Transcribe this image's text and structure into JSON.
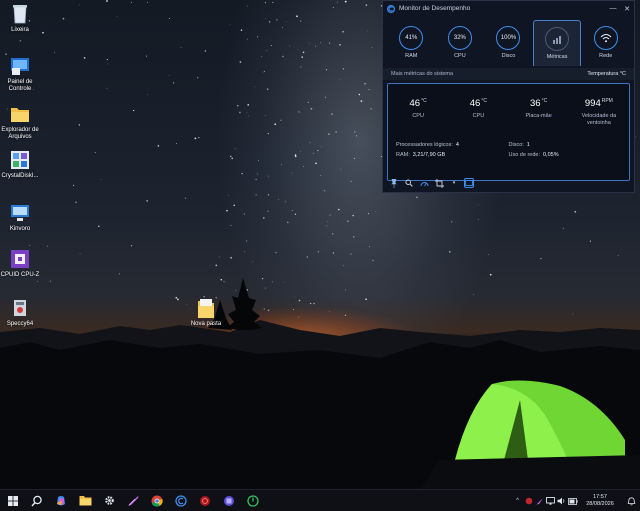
{
  "desktop": {
    "icons": [
      {
        "label": "Lixeira",
        "icon": "recycle-bin-icon"
      },
      {
        "label": "Painel de Controle",
        "icon": "control-panel-icon"
      },
      {
        "label": "Explorador de Arquivos",
        "icon": "folder-icon"
      },
      {
        "label": "CrystalDiskI...",
        "icon": "crystaldisk-icon"
      },
      {
        "label": "Kinvoro",
        "icon": "monitor-app-icon"
      },
      {
        "label": "CPUID CPU-Z",
        "icon": "cpuz-icon"
      },
      {
        "label": "Speccy64",
        "icon": "speccy-icon"
      },
      {
        "label": "Nova pasta",
        "icon": "new-folder-icon"
      }
    ]
  },
  "perf_window": {
    "title": "Monitor de Desempenho",
    "tabs": [
      {
        "value": "41%",
        "label": "RAM"
      },
      {
        "value": "32%",
        "label": "CPU"
      },
      {
        "value": "100%",
        "label": "Disco"
      },
      {
        "value": "",
        "label": "Métricas"
      },
      {
        "value": "",
        "label": "Rede"
      }
    ],
    "panel_title": "Mais métricas do sistema",
    "panel_unit_label": "Temperatura °C",
    "big_metrics": [
      {
        "value": "46",
        "unit": "°C",
        "label": "CPU"
      },
      {
        "value": "46",
        "unit": "°C",
        "label": "CPU"
      },
      {
        "value": "36",
        "unit": "°C",
        "label": "Placa-mãe"
      },
      {
        "value": "994",
        "unit": "RPM",
        "label": "Velocidade da ventoinha"
      }
    ],
    "info": {
      "logical_label": "Processadores lógicos:",
      "logical_value": "4",
      "disk_label": "Disco:",
      "disk_value": "1",
      "ram_label": "RAM:",
      "ram_value": "3,21/7,90 GB",
      "net_label": "Uso de rede:",
      "net_value": "0,05%"
    }
  },
  "taskbar": {
    "time": "17:57",
    "date": "28/08/2026",
    "apps": [
      "windows-start-icon",
      "search-icon",
      "copilot-icon",
      "file-explorer-icon",
      "settings-gear-icon",
      "feather-app-icon",
      "chrome-icon",
      "monitor-c-icon",
      "red-app-icon",
      "blue-app-icon",
      "green-power-icon"
    ]
  },
  "colors": {
    "accent": "#3d8ef0",
    "tent_green": "#7de23a",
    "window_bg": "#0f1522"
  }
}
